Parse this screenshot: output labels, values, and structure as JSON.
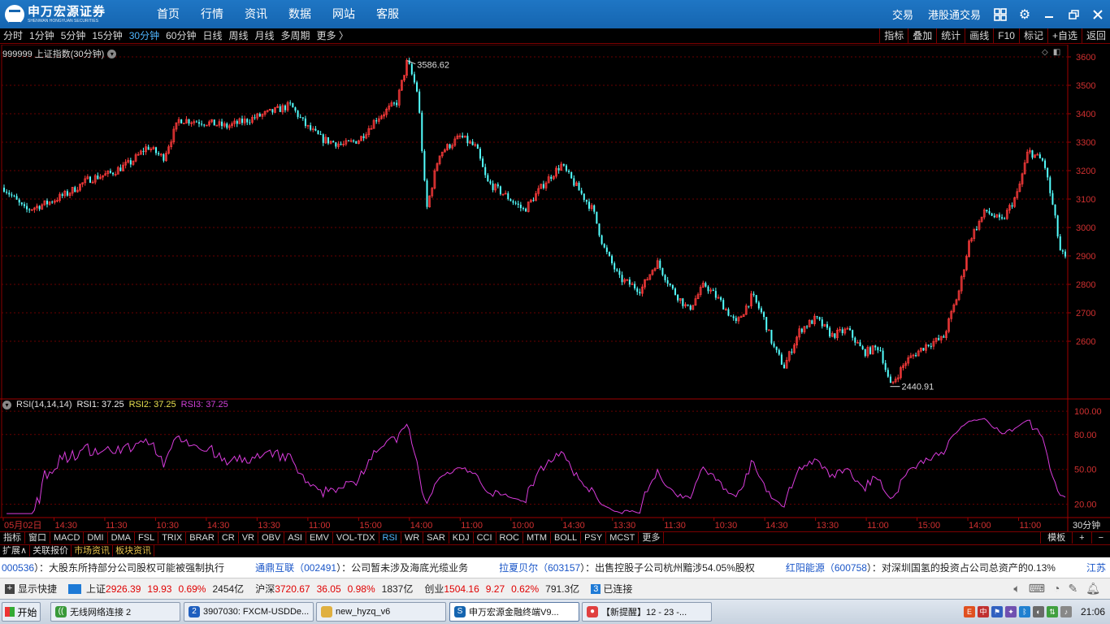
{
  "app": {
    "logo_cn": "申万宏源证券",
    "logo_en": "SHENWAN HONGYUAN SECURITIES",
    "nav": [
      "首页",
      "行情",
      "资讯",
      "数据",
      "网站",
      "客服"
    ],
    "right_links": [
      "交易",
      "港股通交易"
    ]
  },
  "period_bar": {
    "items": [
      "分时",
      "1分钟",
      "5分钟",
      "15分钟",
      "30分钟",
      "60分钟",
      "日线",
      "周线",
      "月线",
      "多周期",
      "更多 〉"
    ],
    "active": "30分钟",
    "tools": [
      "指标",
      "叠加",
      "统计",
      "画线",
      "F10",
      "标记",
      "+自选",
      "返回"
    ]
  },
  "main_chart": {
    "title": "999999 上证指数(30分钟)",
    "high_label": "3586.62",
    "low_label": "2440.91"
  },
  "rsi": {
    "name": "RSI(14,14,14)",
    "rsi1": "RSI1: 37.25",
    "rsi2": "RSI2: 37.25",
    "rsi3": "RSI3: 37.25"
  },
  "chart_data": [
    {
      "type": "candlestick",
      "title": "999999 上证指数(30分钟)",
      "y_ticks": [
        2600,
        2700,
        2800,
        2900,
        3000,
        3100,
        3200,
        3300,
        3400,
        3500,
        3600
      ],
      "ylim": [
        2400,
        3620
      ],
      "max_label": 3586.62,
      "min_label": 2440.91,
      "close_path": [
        [
          0,
          3140
        ],
        [
          0.02,
          3060
        ],
        [
          0.04,
          3085
        ],
        [
          0.06,
          3120
        ],
        [
          0.08,
          3170
        ],
        [
          0.1,
          3190
        ],
        [
          0.12,
          3230
        ],
        [
          0.135,
          3285
        ],
        [
          0.15,
          3245
        ],
        [
          0.165,
          3380
        ],
        [
          0.19,
          3370
        ],
        [
          0.21,
          3355
        ],
        [
          0.235,
          3385
        ],
        [
          0.255,
          3410
        ],
        [
          0.27,
          3430
        ],
        [
          0.285,
          3355
        ],
        [
          0.3,
          3310
        ],
        [
          0.32,
          3290
        ],
        [
          0.335,
          3310
        ],
        [
          0.35,
          3380
        ],
        [
          0.37,
          3440
        ],
        [
          0.38,
          3586.62
        ],
        [
          0.39,
          3470
        ],
        [
          0.398,
          3060
        ],
        [
          0.41,
          3260
        ],
        [
          0.43,
          3320
        ],
        [
          0.445,
          3280
        ],
        [
          0.455,
          3160
        ],
        [
          0.47,
          3120
        ],
        [
          0.49,
          3060
        ],
        [
          0.51,
          3160
        ],
        [
          0.525,
          3220
        ],
        [
          0.54,
          3140
        ],
        [
          0.555,
          3060
        ],
        [
          0.565,
          2930
        ],
        [
          0.58,
          2820
        ],
        [
          0.6,
          2780
        ],
        [
          0.615,
          2880
        ],
        [
          0.63,
          2780
        ],
        [
          0.645,
          2710
        ],
        [
          0.66,
          2800
        ],
        [
          0.675,
          2740
        ],
        [
          0.69,
          2660
        ],
        [
          0.705,
          2760
        ],
        [
          0.715,
          2690
        ],
        [
          0.725,
          2580
        ],
        [
          0.735,
          2510
        ],
        [
          0.75,
          2640
        ],
        [
          0.765,
          2680
        ],
        [
          0.78,
          2620
        ],
        [
          0.795,
          2640
        ],
        [
          0.81,
          2560
        ],
        [
          0.825,
          2580
        ],
        [
          0.835,
          2440.91
        ],
        [
          0.85,
          2530
        ],
        [
          0.87,
          2590
        ],
        [
          0.885,
          2610
        ],
        [
          0.9,
          2780
        ],
        [
          0.91,
          2960
        ],
        [
          0.925,
          3060
        ],
        [
          0.94,
          3020
        ],
        [
          0.955,
          3120
        ],
        [
          0.965,
          3270
        ],
        [
          0.98,
          3230
        ],
        [
          0.99,
          3040
        ],
        [
          0.995,
          2920
        ],
        [
          1.0,
          2890
        ]
      ]
    },
    {
      "type": "line",
      "title": "RSI(14,14,14)",
      "series": [
        {
          "name": "RSI1",
          "last": 37.25
        },
        {
          "name": "RSI2",
          "last": 37.25
        },
        {
          "name": "RSI3",
          "last": 37.25
        }
      ],
      "y_ticks": [
        20.0,
        50.0,
        80.0,
        100.0
      ],
      "ylim": [
        10,
        105
      ]
    }
  ],
  "x_axis": {
    "labels": [
      "05月02日",
      "14:30",
      "11:30",
      "10:30",
      "14:30",
      "13:30",
      "11:00",
      "15:00",
      "14:00",
      "11:00",
      "10:00",
      "14:30",
      "13:30",
      "11:30",
      "10:30",
      "14:30",
      "13:30",
      "11:00",
      "15:00",
      "14:00",
      "11:00"
    ],
    "period": "30分钟"
  },
  "indicator_bar": {
    "items": [
      "指标",
      "窗口",
      "MACD",
      "DMI",
      "DMA",
      "FSL",
      "TRIX",
      "BRAR",
      "CR",
      "VR",
      "OBV",
      "ASI",
      "EMV",
      "VOL-TDX",
      "RSI",
      "WR",
      "SAR",
      "KDJ",
      "CCI",
      "ROC",
      "MTM",
      "BOLL",
      "PSY",
      "MCST",
      "更多"
    ],
    "active": "RSI",
    "right": [
      "模板",
      "+",
      "−"
    ]
  },
  "ext_bar": {
    "items": [
      "扩展∧",
      "关联报价",
      "市场资讯",
      "板块资讯"
    ]
  },
  "ticker": [
    {
      "code": "000536",
      "text": "）：大股东所持部分公司股权可能被强制执行"
    },
    {
      "code": "通鼎互联（002491",
      "text": "）：公司暂未涉及海底光缆业务"
    },
    {
      "code": "拉夏贝尔（603157",
      "text": "）：出售控股子公司杭州黯涉54.05%股权"
    },
    {
      "code": "红阳能源（600758",
      "text": "）：对深圳国氢的投资占公司总资产的0.13%"
    },
    {
      "code": "江苏",
      "text": ""
    }
  ],
  "index_bar": {
    "show_label": "显示快捷",
    "sh_label": "上证",
    "sh_val": "2926.39",
    "sh_chg": "19.93",
    "sh_pct": "0.69%",
    "sh_amt": "2454亿",
    "hs_label": "沪深",
    "hs_val": "3720.67",
    "hs_chg": "36.05",
    "hs_pct": "0.98%",
    "hs_amt": "1837亿",
    "cy_label": "创业",
    "cy_val": "1504.16",
    "cy_chg": "9.27",
    "cy_pct": "0.62%",
    "cy_amt": "791.3亿",
    "conn_num": "3",
    "conn_text": "已连接"
  },
  "taskbar": {
    "start": "开始",
    "tasks": [
      "无线网络连接 2",
      "3907030: FXCM-USDDe...",
      "new_hyzq_v6",
      "申万宏源金融终端V9...",
      "【新提醒】12 - 23 -..."
    ],
    "clock": "21:06"
  }
}
